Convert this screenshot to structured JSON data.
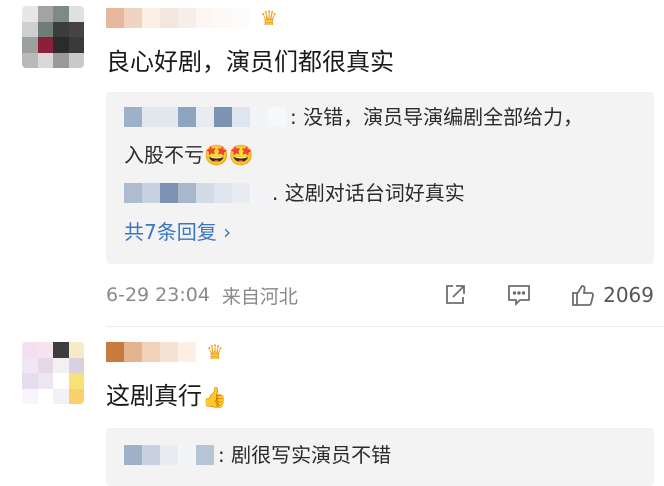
{
  "comments": [
    {
      "text": "良心好剧，演员们都很真实",
      "crown_icon": "crown-icon",
      "replies": [
        {
          "line1": ": 没错，演员导演编剧全部给力，",
          "line2": "入股不亏",
          "emoji": "🤩🤩"
        },
        {
          "text": ". 这剧对话台词好真实"
        }
      ],
      "more_replies": "共7条回复 ›",
      "date": "6-29 23:04",
      "location": "来自河北",
      "like_count": "2069"
    },
    {
      "text": "这剧真行",
      "emoji": "👍",
      "crown_icon": "crown-icon",
      "replies": [
        {
          "text": ": 剧很写实演员不错"
        }
      ]
    }
  ],
  "colors": {
    "link": "#3b76c4",
    "meta": "#8a8a8a",
    "reply_bg": "#f3f3f3",
    "crown": "#e8a21a"
  }
}
